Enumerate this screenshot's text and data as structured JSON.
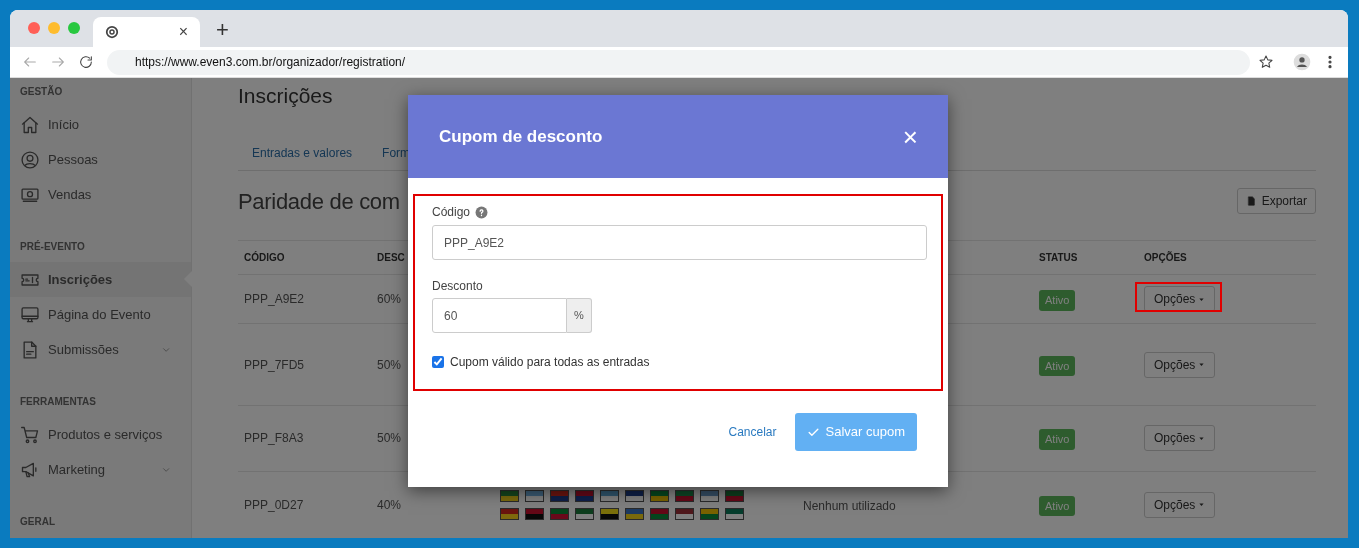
{
  "browser": {
    "url": "https://www.even3.com.br/organizador/registration/",
    "tab_close": "×",
    "new_tab": "+"
  },
  "sidebar": {
    "sections": [
      {
        "title": "GESTÃO",
        "items": [
          {
            "label": "Início",
            "selected": false
          },
          {
            "label": "Pessoas",
            "selected": false
          },
          {
            "label": "Vendas",
            "selected": false
          }
        ]
      },
      {
        "title": "PRÉ-EVENTO",
        "items": [
          {
            "label": "Inscrições",
            "selected": true
          },
          {
            "label": "Página do Evento",
            "selected": false
          },
          {
            "label": "Submissões",
            "selected": false,
            "expandable": true
          }
        ]
      },
      {
        "title": "FERRAMENTAS",
        "items": [
          {
            "label": "Produtos e serviços",
            "selected": false
          },
          {
            "label": "Marketing",
            "selected": false,
            "expandable": true
          }
        ]
      },
      {
        "title": "GERAL"
      }
    ]
  },
  "page": {
    "title": "Inscrições",
    "tabs": [
      {
        "label": "Entradas e valores",
        "selected": false
      },
      {
        "label": "Form",
        "selected": false
      }
    ],
    "section_title": "Paridade de com",
    "export_button": "Exportar",
    "table": {
      "columns": [
        "CÓDIGO",
        "DESC",
        "",
        "",
        "STATUS",
        "OPÇÕES"
      ],
      "rows": [
        {
          "kind": "plain",
          "code": "PPP_A9E2",
          "discount": "60%",
          "status": "Ativo",
          "options": "Opções",
          "highlighted": true
        },
        {
          "kind": "plain",
          "code": "PPP_7FD5",
          "discount": "50%",
          "status": "Ativo",
          "options": "Opções",
          "highlighted": false
        },
        {
          "kind": "plain",
          "code": "PPP_F8A3",
          "discount": "50%",
          "status": "Ativo",
          "options": "Opções",
          "highlighted": false
        },
        {
          "kind": "flags",
          "code": "PPP_0D27",
          "discount": "40%",
          "usage": "Nenhum utilizado",
          "status": "Ativo",
          "options": "Opções",
          "highlighted": false
        }
      ]
    }
  },
  "modal": {
    "title": "Cupom de desconto",
    "close": "×",
    "form_highlighted": true,
    "code_label": "Código",
    "code_value": "PPP_A9E2",
    "discount_label": "Desconto",
    "discount_value": "60",
    "discount_unit": "%",
    "all_entries": {
      "label": "Cupom válido para todas as entradas",
      "checked": true
    },
    "cancel": "Cancelar",
    "save": "Salvar cupom"
  }
}
